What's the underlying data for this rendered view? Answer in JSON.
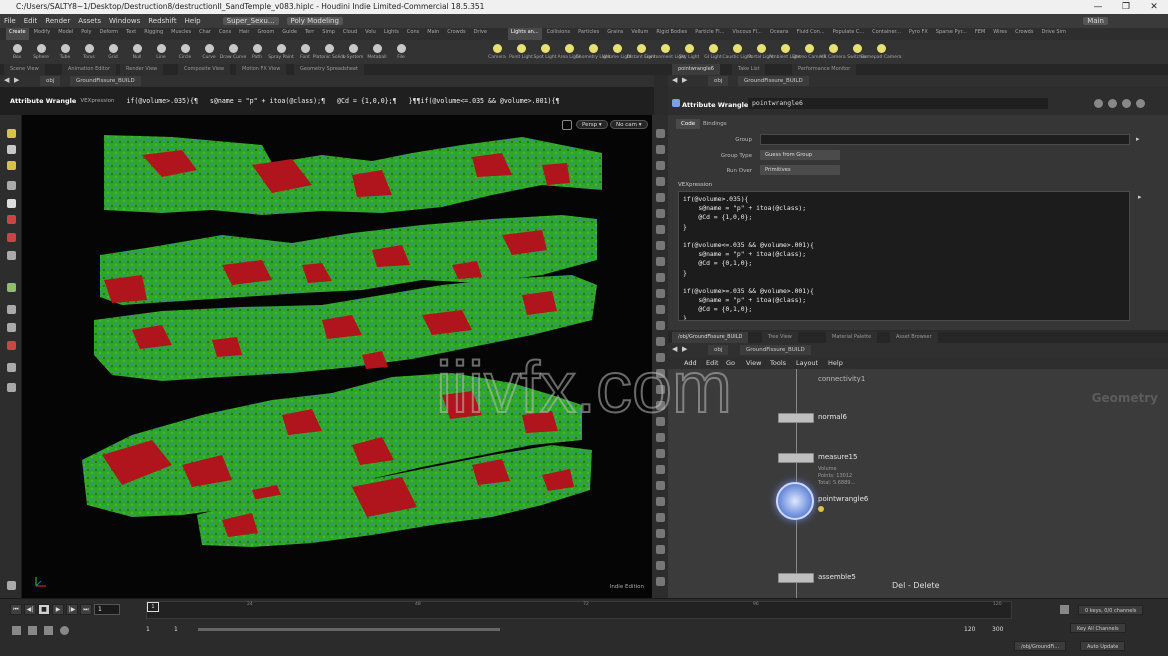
{
  "window": {
    "title": "C:/Users/SALTY8~1/Desktop/Destruction8/destructionII_SandTemple_v083.hiplc - Houdini Indie Limited-Commercial 18.5.351",
    "minimize": "—",
    "maximize": "❐",
    "close": "✕"
  },
  "menubar": {
    "items": [
      "File",
      "Edit",
      "Render",
      "Assets",
      "Windows",
      "Redshift",
      "Help"
    ],
    "desktop": "Super_Sexu...",
    "mode": "Poly Modeling",
    "main_badge": "Main"
  },
  "shelf": {
    "tabs_left": [
      "Create",
      "Modify",
      "Model",
      "Poly",
      "Deform",
      "Text",
      "Rigging",
      "Muscles",
      "Char",
      "Cons",
      "Hair",
      "Groom",
      "Guide",
      "Terr",
      "Simp",
      "Cloud",
      "Volu",
      "Lights",
      "Cons",
      "Main",
      "Crowds",
      "Drive"
    ],
    "tabs_right": [
      "Lights an...",
      "Collisions",
      "Particles",
      "Grains",
      "Vellum",
      "Rigid Bodies",
      "Particle Fl...",
      "Viscous Fl...",
      "Oceans",
      "Fluid Con...",
      "Populate C...",
      "Container...",
      "Pyro FX",
      "Sparse Pyr...",
      "FEM",
      "Wires",
      "Crowds",
      "Drive Sim"
    ],
    "tools_left": [
      "Box",
      "Sphere",
      "Tube",
      "Torus",
      "Grid",
      "Null",
      "Line",
      "Circle",
      "Curve",
      "Draw Curve",
      "Path",
      "Spray Paint",
      "Font",
      "Platonic Solids",
      "L-System",
      "Metaball",
      "File"
    ],
    "tools_right": [
      "Camera",
      "Point Light",
      "Spot Light",
      "Area Light",
      "Geometry Light",
      "Volume Light",
      "Distant Light",
      "Environment Light",
      "Sky Light",
      "GI Light",
      "Caustic Light",
      "Portal Light",
      "Ambient Light",
      "Stereo Camera",
      "VR Camera",
      "Switcher",
      "Gamepad Camera"
    ]
  },
  "pane_tabs_left": [
    "Scene View",
    "Animation Editor",
    "Render View",
    "Composite View",
    "Motion FX View",
    "Geometry Spreadsheet"
  ],
  "pane_tabs_right": [
    "pointwrangle6",
    "Take List",
    "Performance Monitor"
  ],
  "viewport": {
    "path_root": "obj",
    "path_node": "GroundFissure_BUILD",
    "status_label": "Attribute Wrangle",
    "status_sub": "VEXpression",
    "status_code": [
      "if(@volume>.035){¶",
      "s@name = \"p\" + itoa(@class);¶",
      "@Cd = {1,0,0};¶",
      "}¶¶if(@volume<=.035 && @volume>.001){¶"
    ],
    "persp": "Persp ▾",
    "cam": "No cam ▾",
    "indie": "Indie Edition"
  },
  "parms": {
    "path_root": "obj",
    "path_node": "GroundFissure_BUILD",
    "node_type": "Attribute Wrangle",
    "node_name": "pointwrangle6",
    "tabs": [
      "Code",
      "Bindings"
    ],
    "group_label": "Group",
    "group_type_label": "Group Type",
    "group_type_value": "Guess from Group",
    "run_over_label": "Run Over",
    "run_over_value": "Primitives",
    "vex_label": "VEXpression",
    "code_lines": [
      "if(@volume>.035){",
      "    s@name = \"p\" + itoa(@class);",
      "    @Cd = {1,0,0};",
      "}",
      "",
      "if(@volume<=.035 && @volume>.001){",
      "    s@name = \"p\" + itoa(@class);",
      "    @Cd = {0,1,0};",
      "}",
      "",
      "if(@volume>=.035 && @volume>.001){",
      "    s@name = \"p\" + itoa(@class);",
      "    @Cd = {0,1,0};",
      "}"
    ]
  },
  "network": {
    "tabs": [
      "/obj/GroundFissure_BUILD",
      "Tree View",
      "Material Palette",
      "Asset Browser"
    ],
    "path_root": "obj",
    "path_node": "GroundFissure_BUILD",
    "menu": [
      "Add",
      "Edit",
      "Go",
      "View",
      "Tools",
      "Layout",
      "Help"
    ],
    "context": "Geometry",
    "nodes": [
      {
        "name": "normal6",
        "info": []
      },
      {
        "name": "measure15",
        "info": [
          "Volume",
          "Points: 13012",
          "Total: 5.6889..."
        ]
      },
      {
        "name": "pointwrangle6",
        "info": []
      },
      {
        "name": "assemble5",
        "info": []
      }
    ],
    "top_clip": "connectivity1",
    "hotkey": "Del - Delete"
  },
  "timeline": {
    "frame": "1",
    "playhead": "1",
    "ticks": [
      "24",
      "48",
      "72",
      "96",
      "120"
    ],
    "start": "1",
    "range_start": "1",
    "range_end": "120",
    "end": "300",
    "keys_label": "0 keys, 0/0 channels",
    "channels_label": "Key All Channels",
    "auto_update": "Auto Update",
    "status_path": "/obj/GroundFi..."
  },
  "watermark": "iiivfx.com"
}
